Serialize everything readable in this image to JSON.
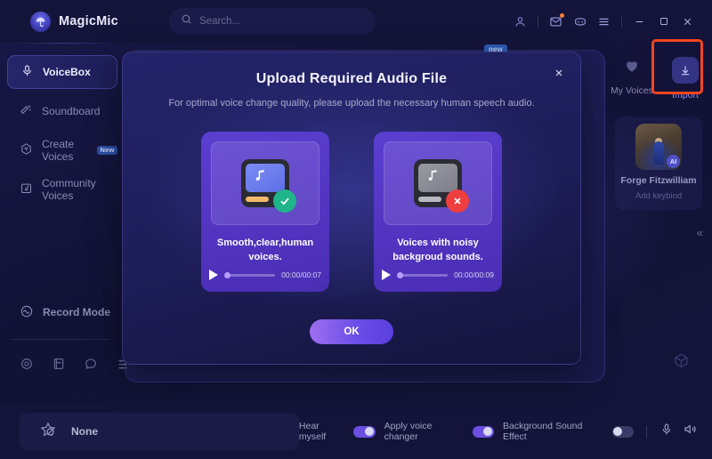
{
  "app": {
    "brand": "MagicMic",
    "brand_logo_icon": "umbrella-logo-icon"
  },
  "search": {
    "placeholder": "Search...",
    "icon": "search-icon"
  },
  "titlebar": {
    "icons": [
      {
        "name": "account-icon",
        "glyph": "person"
      },
      {
        "name": "mail-icon",
        "glyph": "envelope",
        "has_badge": true
      },
      {
        "name": "discord-icon",
        "glyph": "discord"
      },
      {
        "name": "menu-icon",
        "glyph": "hamburger"
      }
    ],
    "window_controls": [
      {
        "name": "minimize-button",
        "glyph": "minus"
      },
      {
        "name": "maximize-button",
        "glyph": "square"
      },
      {
        "name": "close-button",
        "glyph": "x"
      }
    ]
  },
  "sidebar": {
    "items": [
      {
        "label": "VoiceBox",
        "icon": "microphone-icon",
        "active": true,
        "badge": ""
      },
      {
        "label": "Soundboard",
        "icon": "magic-wand-icon",
        "active": false,
        "badge": ""
      },
      {
        "label": "Create Voices",
        "icon": "hexagon-y-icon",
        "active": false,
        "badge": "New"
      },
      {
        "label": "Community Voices",
        "icon": "folder-music-icon",
        "active": false,
        "badge": ""
      }
    ],
    "record_mode": {
      "label": "Record Mode",
      "icon": "waveform-circle-icon"
    },
    "mini_icons": [
      {
        "name": "record-target-icon"
      },
      {
        "name": "tutorial-book-icon"
      },
      {
        "name": "feedback-chat-icon"
      },
      {
        "name": "settings-sliders-icon"
      }
    ]
  },
  "main": {
    "peek_badge": "new",
    "rail": {
      "actions": [
        {
          "label": "My Voices",
          "icon": "heart-icon",
          "highlighted": false
        },
        {
          "label": "Import",
          "icon": "download-arrow-icon",
          "highlighted": true
        }
      ],
      "voice_card": {
        "name": "Forge Fitzwilliam",
        "keybind_label": "Add keybind",
        "ai_badge": "AI",
        "avatar_icon": "character-portrait-icon"
      },
      "collapse_icon": "chevron-double-left-icon",
      "dice_icon": "dice-random-icon"
    }
  },
  "modal": {
    "title": "Upload Required Audio File",
    "subtitle": "For optimal voice change quality, please upload the necessary human speech audio.",
    "close_icon": "close-icon",
    "ok_label": "OK",
    "cards": [
      {
        "label": "Smooth,clear,human voices.",
        "status": "good",
        "status_icon": "check-circle-icon",
        "file_icon": "music-file-icon",
        "time": "00:00/00:07",
        "play_icon": "play-icon"
      },
      {
        "label": "Voices with noisy backgroud sounds.",
        "status": "bad",
        "status_icon": "x-circle-icon",
        "file_icon": "music-file-icon",
        "time": "00:00/00:09",
        "play_icon": "play-icon"
      }
    ]
  },
  "bottombar": {
    "current_voice": "None",
    "current_icon": "star-disabled-icon",
    "toggles": [
      {
        "label": "Hear myself",
        "state": "on"
      },
      {
        "label": "Apply voice changer",
        "state": "on"
      },
      {
        "label": "Background Sound Effect",
        "state": "off"
      }
    ],
    "icons": [
      {
        "name": "microphone-level-icon"
      },
      {
        "name": "speaker-volume-icon"
      }
    ]
  },
  "colors": {
    "accent_purple": "#6a4fe0",
    "highlight_red": "#f5451f",
    "success_green": "#1fb489",
    "error_red": "#ef3e3e",
    "badge_blue": "#2c4fa8",
    "window_bg": "#14143a"
  }
}
